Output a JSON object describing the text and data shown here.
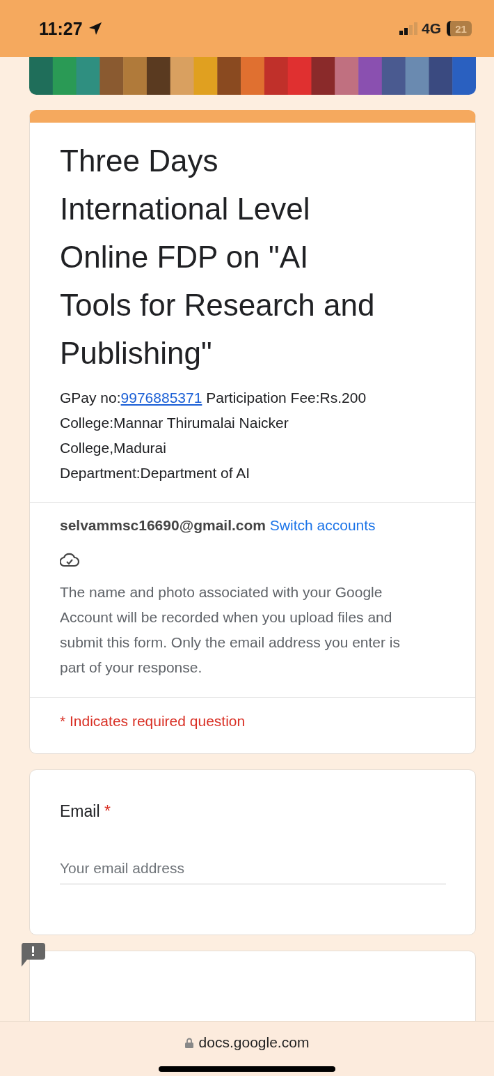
{
  "status_bar": {
    "time": "11:27",
    "network": "4G",
    "battery": "21"
  },
  "header": {
    "title": "Three Days International Level Online FDP on \"AI Tools for Research and Publishing\"",
    "fee_line": {
      "before_link": "GPay no:",
      "link": "9976885371",
      "after_link": " Participation Fee:Rs.200"
    },
    "lines": [
      "College:Mannar Thirumalai Naicker College,Madurai",
      "Department:Department of AI"
    ],
    "account": {
      "email": "selvammsc16690@gmail.com",
      "switch_link": "Switch accounts"
    },
    "notice": "The name and photo associated with your Google Account will be recorded when you upload files and submit this form. Only the email address you enter is part of your response.",
    "required_note": "* Indicates required question"
  },
  "questions": [
    {
      "label": "Email",
      "required": true,
      "required_mark": "*",
      "placeholder": "Your email address"
    }
  ],
  "address_bar": {
    "url": "docs.google.com"
  }
}
